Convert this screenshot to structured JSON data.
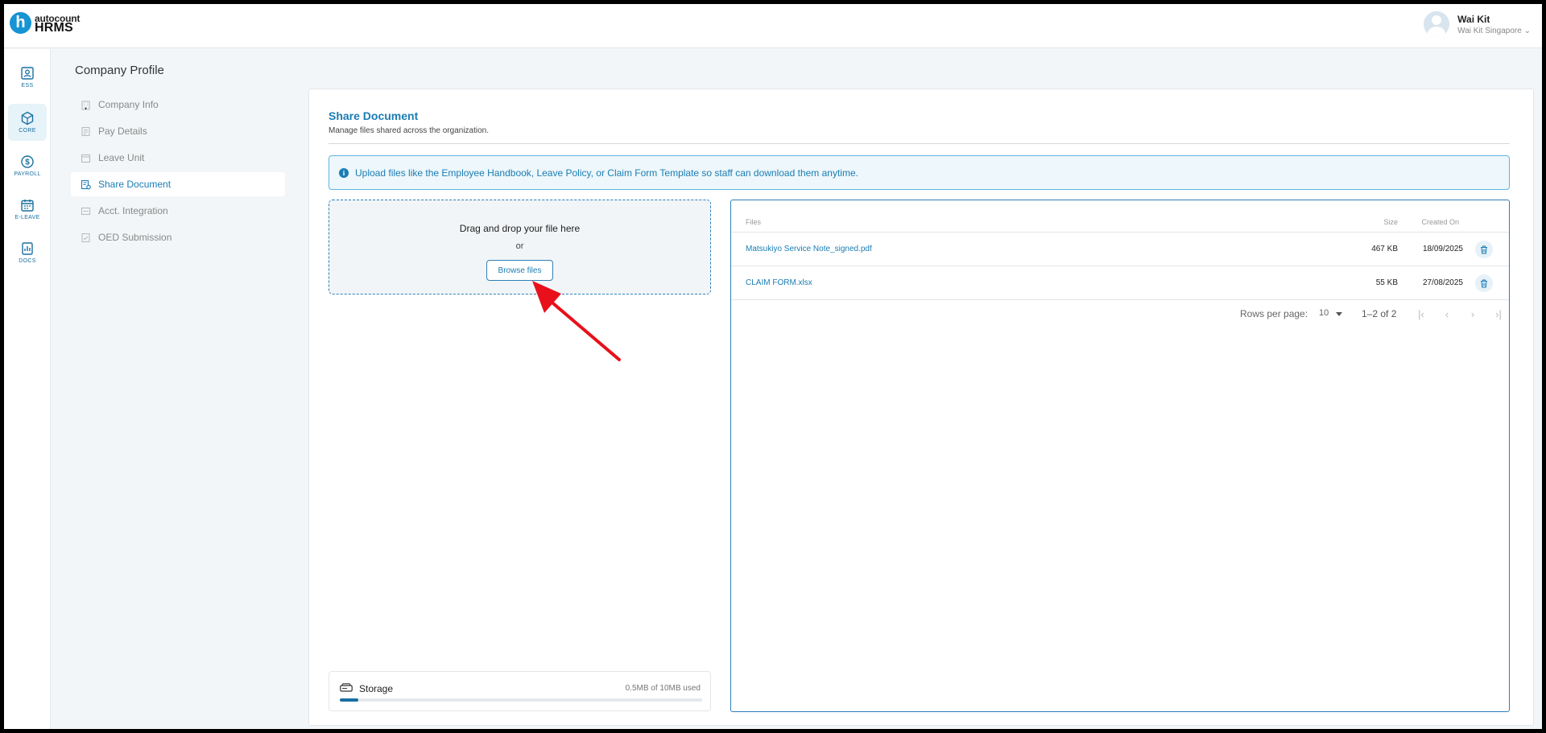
{
  "app": {
    "logo_top": "autocount",
    "logo_bottom": "HRMS",
    "logo_letter": "h"
  },
  "user": {
    "name": "Wai Kit",
    "org": "Wai Kit Singapore",
    "caret": "⌄"
  },
  "rail": {
    "items": [
      {
        "label": "ESS",
        "icon": "ess-icon"
      },
      {
        "label": "CORE",
        "icon": "core-icon"
      },
      {
        "label": "PAYROLL",
        "icon": "payroll-icon"
      },
      {
        "label": "E-LEAVE",
        "icon": "calendar-icon"
      },
      {
        "label": "DOCS",
        "icon": "docs-icon"
      }
    ]
  },
  "page": {
    "title": "Company Profile"
  },
  "subnav": {
    "items": [
      {
        "label": "Company Info"
      },
      {
        "label": "Pay Details"
      },
      {
        "label": "Leave Unit"
      },
      {
        "label": "Share Document"
      },
      {
        "label": "Acct. Integration"
      },
      {
        "label": "OED Submission"
      }
    ]
  },
  "share": {
    "title": "Share Document",
    "subtitle": "Manage files shared across the organization.",
    "info": "Upload files like the Employee Handbook, Leave Policy, or Claim Form Template so staff can download them anytime.",
    "drop_text": "Drag and drop your file here",
    "or_text": "or",
    "browse_label": "Browse files"
  },
  "storage": {
    "label": "Storage",
    "used_text": "0.5MB of 10MB used",
    "used_fraction": 0.05
  },
  "table": {
    "headers": {
      "files": "Files",
      "size": "Size",
      "created": "Created On"
    },
    "rows": [
      {
        "file": "Matsukiyo Service Note_signed.pdf",
        "size": "467 KB",
        "created": "18/09/2025"
      },
      {
        "file": "CLAIM FORM.xlsx",
        "size": "55 KB",
        "created": "27/08/2025"
      }
    ],
    "rows_per_page_label": "Rows per page:",
    "rows_per_page_value": "10",
    "range": "1–2 of 2"
  },
  "colors": {
    "accent": "#1a7db4",
    "annotation_arrow": "#e8101a"
  }
}
